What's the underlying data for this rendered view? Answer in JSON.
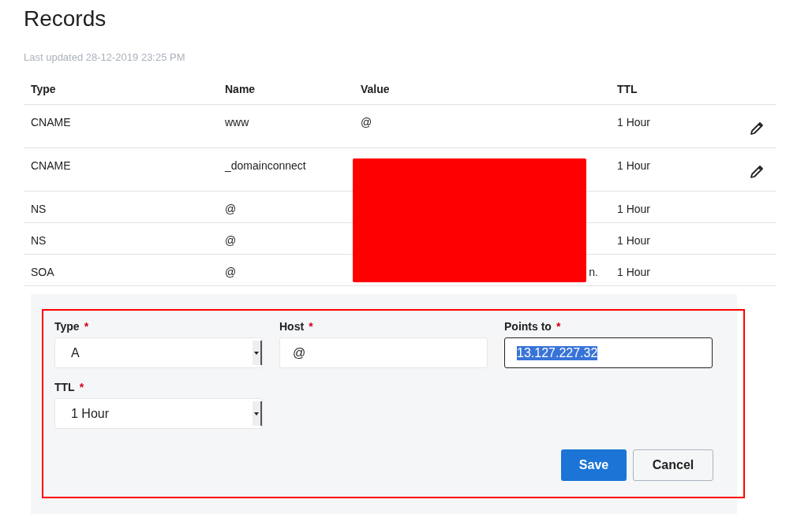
{
  "title": "Records",
  "last_updated": "Last updated 28-12-2019 23:25 PM",
  "table": {
    "columns": [
      "Type",
      "Name",
      "Value",
      "TTL"
    ],
    "rows": [
      {
        "type": "CNAME",
        "name": "www",
        "value": "@",
        "ttl": "1 Hour",
        "editable": true
      },
      {
        "type": "CNAME",
        "name": "_domainconnect",
        "ttl": "1 Hour",
        "editable": true
      },
      {
        "type": "NS",
        "name": "@",
        "ttl": "1 Hour",
        "editable": false
      },
      {
        "type": "NS",
        "name": "@",
        "ttl": "1 Hour",
        "editable": false
      },
      {
        "type": "SOA",
        "name": "@",
        "value": "n.",
        "value_partial": true,
        "ttl": "1 Hour",
        "editable": false
      }
    ],
    "redacted": true
  },
  "form": {
    "fields": [
      {
        "kind": "select",
        "label": "Type",
        "required": "*",
        "value": "A"
      },
      {
        "kind": "text",
        "label": "Host",
        "required": "*",
        "value": "@"
      },
      {
        "kind": "text",
        "label": "Points to",
        "required": "*",
        "value": "13.127.227.32",
        "focused": true,
        "text_selected": true
      },
      {
        "kind": "select",
        "label": "TTL",
        "required": "*",
        "value": "1 Hour"
      }
    ],
    "buttons": [
      {
        "label": "Save",
        "kind": "primary"
      },
      {
        "label": "Cancel",
        "kind": "secondary"
      }
    ],
    "highlighted": true
  }
}
